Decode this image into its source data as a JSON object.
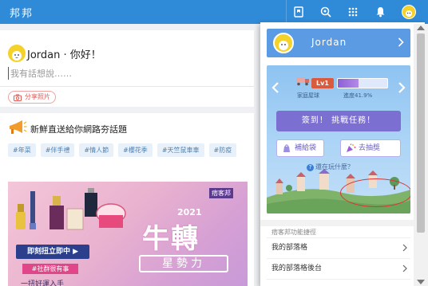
{
  "topbar": {
    "brand": "邦邦",
    "color": "#2f8ad8",
    "icons": [
      "bookmark-icon",
      "search-icon",
      "apps-grid-icon",
      "bell-icon",
      "user-avatar"
    ]
  },
  "post": {
    "greeting": "Jordan · 你好！",
    "placeholder": "我有話想說……",
    "share_photo": "分享照片"
  },
  "news": {
    "title": "新鮮直送給你網路夯話題",
    "tags": [
      "#年菜",
      "#伴手禮",
      "#情人節",
      "#櫻花季",
      "#天竺鼠車車",
      "#防疫"
    ],
    "banner": {
      "cta": "即刻扭立即中 ▶",
      "hashtag": "#社群很有事",
      "bottom_text": "一扭好運入手",
      "big_text": "牛轉",
      "year": "2021",
      "star_text": "星勢力",
      "logo": "痞客邦"
    }
  },
  "dropdown": {
    "user_name": "Jordan",
    "game": {
      "level": "Lv1",
      "level_name": "家庭屋球",
      "progress_label": "進度41.9%",
      "progress_fraction": 0.419,
      "sign_in_button": "簽到！ 挑戰任務！",
      "bag_button": "補給袋",
      "draw_button": "去抽獎",
      "still_playing": "還在玩什麼？"
    },
    "section_label": "痞客邦功能捷徑",
    "items": [
      "我的部落格",
      "我的部落格後台",
      ""
    ]
  }
}
